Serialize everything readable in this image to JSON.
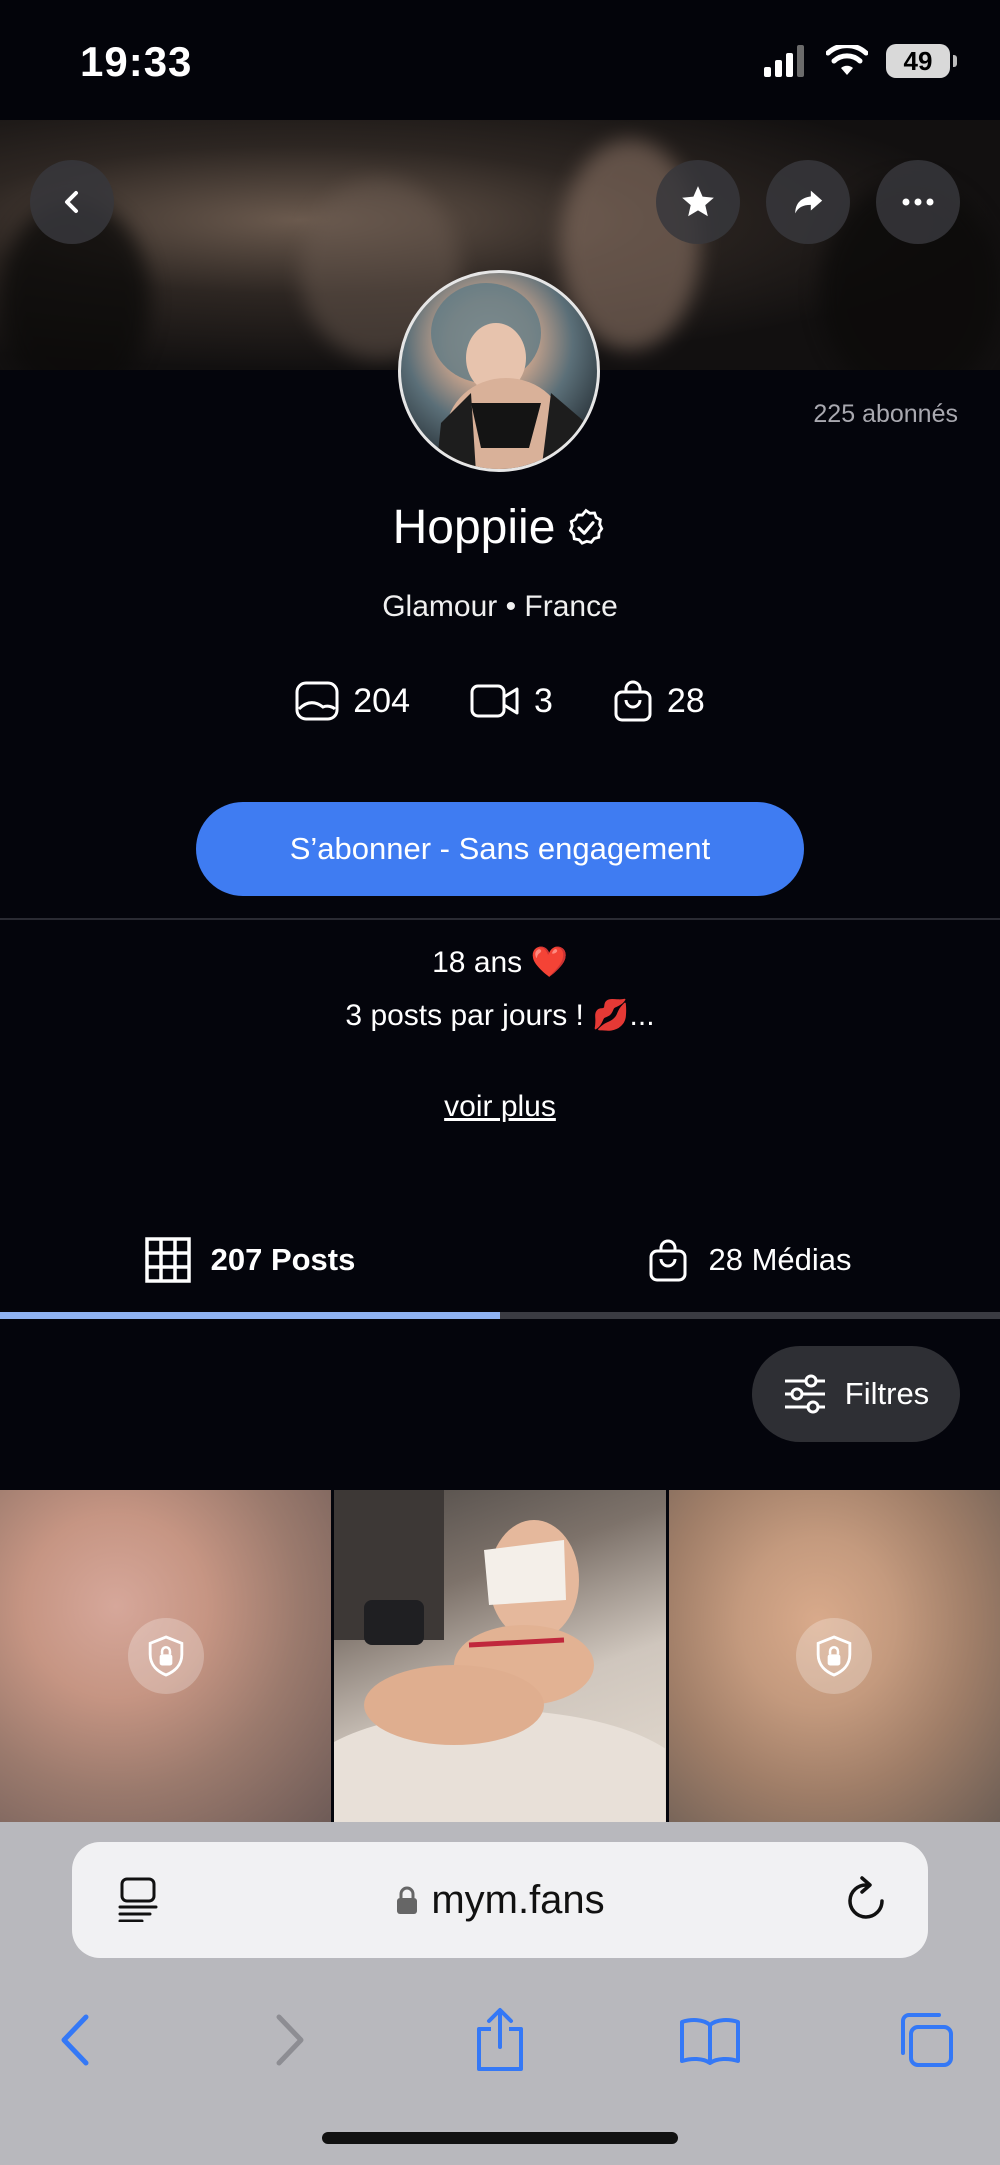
{
  "status_bar": {
    "time": "19:33",
    "battery": "49"
  },
  "profile": {
    "followers": "225 abonnés",
    "name": "Hoppiie",
    "subtitle": "Glamour • France",
    "stats": {
      "photos": "204",
      "videos": "3",
      "medias": "28"
    },
    "subscribe_label": "S’abonner - Sans engagement",
    "bio_line1": "18 ans ❤️",
    "bio_line2": "3 posts par jours ! 💋...",
    "see_more": "voir plus"
  },
  "tabs": [
    {
      "label": "207 Posts",
      "active": true
    },
    {
      "label": "28 Médias",
      "active": false
    }
  ],
  "filter_label": "Filtres",
  "browser": {
    "url": "mym.fans"
  },
  "colors": {
    "accent": "#3f7cf2",
    "tab_indicator": "#8eb2f2",
    "background": "#04050c"
  }
}
